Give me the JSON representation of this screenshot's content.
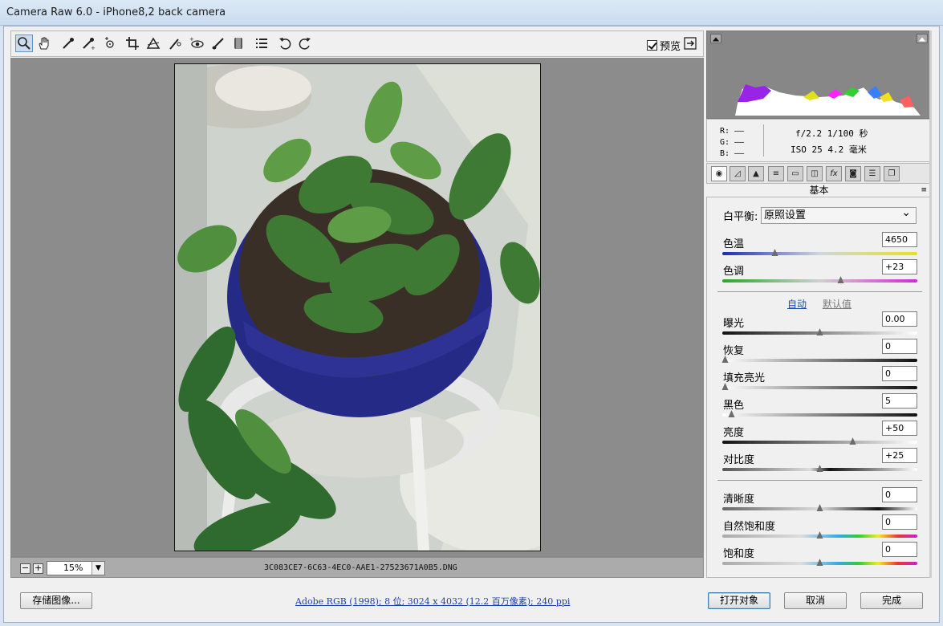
{
  "window": {
    "title": "Camera Raw 6.0 -  iPhone8,2 back camera"
  },
  "toolbar": {
    "tools": [
      {
        "name": "zoom-tool",
        "glyph": "🔍︎"
      },
      {
        "name": "hand-tool",
        "glyph": "✋︎"
      },
      {
        "name": "white-balance-tool",
        "glyph": "⁄"
      },
      {
        "name": "color-sampler-tool",
        "glyph": "⁄"
      },
      {
        "name": "target-adjust-tool",
        "glyph": "⊙"
      },
      {
        "name": "crop-tool",
        "glyph": "⌗"
      },
      {
        "name": "straighten-tool",
        "glyph": "△"
      },
      {
        "name": "spot-removal-tool",
        "glyph": "⁄"
      },
      {
        "name": "red-eye-tool",
        "glyph": "◉"
      },
      {
        "name": "adjustment-brush-tool",
        "glyph": "⁄"
      },
      {
        "name": "graduated-filter-tool",
        "glyph": "▮"
      },
      {
        "name": "preferences-tool",
        "glyph": "☰"
      },
      {
        "name": "rotate-left-tool",
        "glyph": "↺"
      },
      {
        "name": "rotate-right-tool",
        "glyph": "↻"
      }
    ],
    "preview_label": "预览",
    "preview_checked": true
  },
  "status": {
    "zoom_value": "15%",
    "filename": "3C083CE7-6C63-4EC0-AAE1-27523671A0B5.DNG"
  },
  "meta": {
    "r_label": "R:",
    "g_label": "G:",
    "b_label": "B:",
    "dash": "——",
    "aperture_shutter": "f/2.2  1/100 秒",
    "iso_focal": "ISO 25  4.2 毫米"
  },
  "panel": {
    "section_title": "基本",
    "white_balance_label": "白平衡:",
    "white_balance_value": "原照设置",
    "auto_link": "自动",
    "default_link": "默认值",
    "sliders": [
      {
        "key": "temp",
        "label": "色温",
        "value": "4650",
        "pos": 0.27
      },
      {
        "key": "tint",
        "label": "色调",
        "value": "+23",
        "pos": 0.61
      },
      {
        "key": "exposure",
        "label": "曝光",
        "value": "0.00",
        "pos": 0.5
      },
      {
        "key": "recovery",
        "label": "恢复",
        "value": "0",
        "pos": 0.0
      },
      {
        "key": "fill",
        "label": "填充亮光",
        "value": "0",
        "pos": 0.0
      },
      {
        "key": "blacks",
        "label": "黑色",
        "value": "5",
        "pos": 0.05
      },
      {
        "key": "brightness",
        "label": "亮度",
        "value": "+50",
        "pos": 0.67
      },
      {
        "key": "contrast",
        "label": "对比度",
        "value": "+25",
        "pos": 0.5
      },
      {
        "key": "clarity",
        "label": "清晰度",
        "value": "0",
        "pos": 0.5
      },
      {
        "key": "vibrance",
        "label": "自然饱和度",
        "value": "0",
        "pos": 0.5
      },
      {
        "key": "saturation",
        "label": "饱和度",
        "value": "0",
        "pos": 0.5
      }
    ]
  },
  "footer": {
    "save_button": "存储图像...",
    "info_link": "Adobe RGB (1998); 8 位; 3024 x 4032 (12.2 百万像素); 240 ppi",
    "open_button": "打开对象",
    "cancel_button": "取消",
    "done_button": "完成"
  }
}
